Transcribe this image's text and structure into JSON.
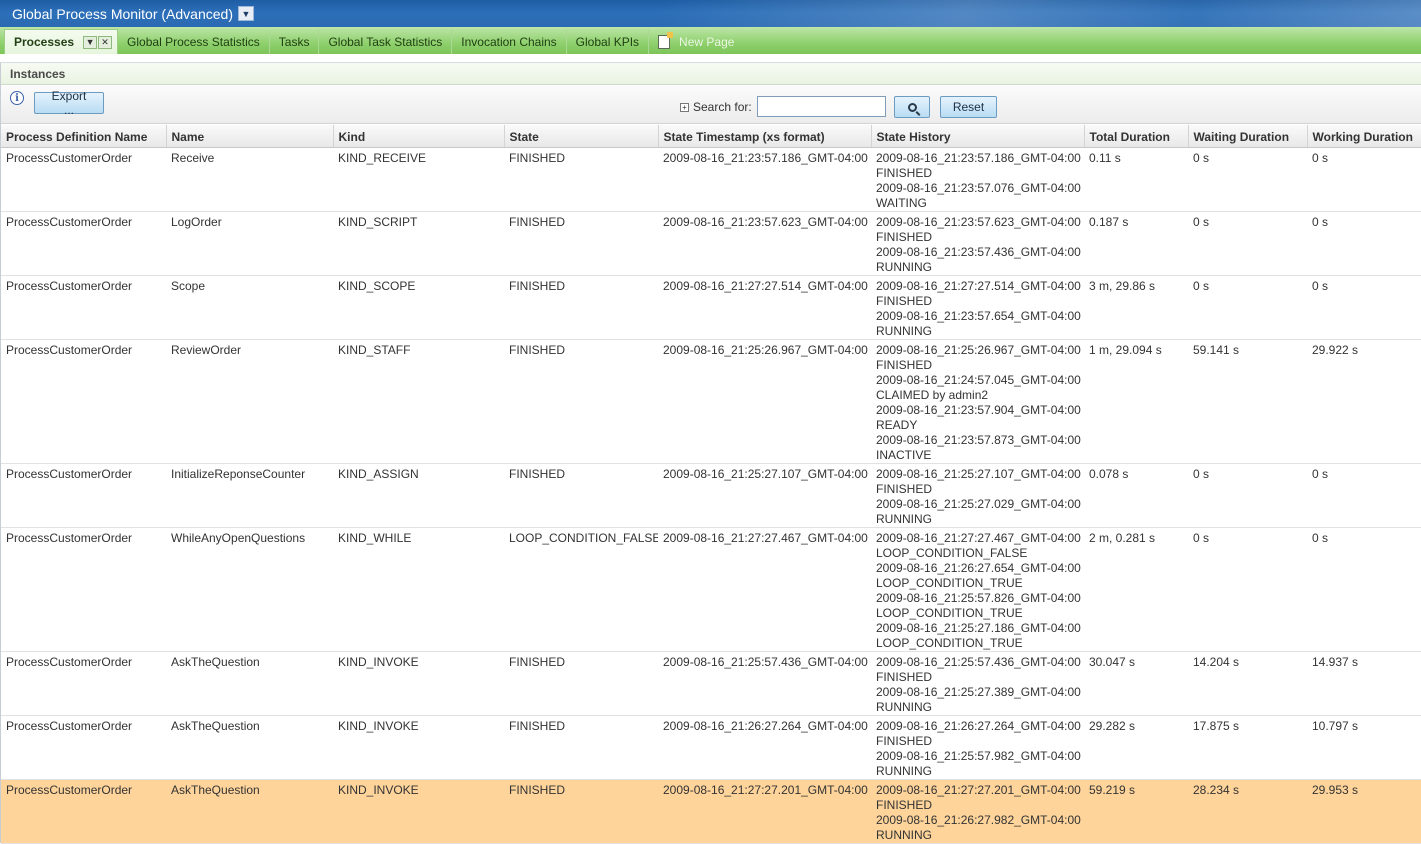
{
  "app": {
    "title": "Global Process Monitor (Advanced)"
  },
  "tabs": [
    {
      "label": "Processes",
      "active": true
    },
    {
      "label": "Global Process Statistics"
    },
    {
      "label": "Tasks"
    },
    {
      "label": "Global Task Statistics"
    },
    {
      "label": "Invocation Chains"
    },
    {
      "label": "Global KPIs"
    },
    {
      "label": "New Page"
    }
  ],
  "portlet": {
    "title": "Instances",
    "export_label": "Export ...",
    "search_label": "Search for:",
    "search_value": "",
    "reset_label": "Reset"
  },
  "table": {
    "columns": [
      "Process Definition Name",
      "Name",
      "Kind",
      "State",
      "State Timestamp (xs format)",
      "State History",
      "Total Duration",
      "Waiting Duration",
      "Working Duration"
    ],
    "rows": [
      {
        "process": "ProcessCustomerOrder",
        "name": "Receive",
        "kind": "KIND_RECEIVE",
        "state": "FINISHED",
        "timestamp": "2009-08-16_21:23:57.186_GMT-04:00",
        "history": [
          "2009-08-16_21:23:57.186_GMT-04:00",
          "FINISHED",
          "2009-08-16_21:23:57.076_GMT-04:00",
          "WAITING"
        ],
        "total": "0.11 s",
        "waiting": "0 s",
        "working": "0 s"
      },
      {
        "process": "ProcessCustomerOrder",
        "name": "LogOrder",
        "kind": "KIND_SCRIPT",
        "state": "FINISHED",
        "timestamp": "2009-08-16_21:23:57.623_GMT-04:00",
        "history": [
          "2009-08-16_21:23:57.623_GMT-04:00",
          "FINISHED",
          "2009-08-16_21:23:57.436_GMT-04:00",
          "RUNNING"
        ],
        "total": "0.187 s",
        "waiting": "0 s",
        "working": "0 s"
      },
      {
        "process": "ProcessCustomerOrder",
        "name": "Scope",
        "kind": "KIND_SCOPE",
        "state": "FINISHED",
        "timestamp": "2009-08-16_21:27:27.514_GMT-04:00",
        "history": [
          "2009-08-16_21:27:27.514_GMT-04:00",
          "FINISHED",
          "2009-08-16_21:23:57.654_GMT-04:00",
          "RUNNING"
        ],
        "total": "3 m, 29.86 s",
        "waiting": "0 s",
        "working": "0 s"
      },
      {
        "process": "ProcessCustomerOrder",
        "name": "ReviewOrder",
        "kind": "KIND_STAFF",
        "state": "FINISHED",
        "timestamp": "2009-08-16_21:25:26.967_GMT-04:00",
        "history": [
          "2009-08-16_21:25:26.967_GMT-04:00",
          "FINISHED",
          "2009-08-16_21:24:57.045_GMT-04:00",
          "CLAIMED by admin2",
          "2009-08-16_21:23:57.904_GMT-04:00",
          "READY",
          "2009-08-16_21:23:57.873_GMT-04:00",
          "INACTIVE"
        ],
        "total": "1 m, 29.094 s",
        "waiting": "59.141 s",
        "working": "29.922 s"
      },
      {
        "process": "ProcessCustomerOrder",
        "name": "InitializeReponseCounter",
        "kind": "KIND_ASSIGN",
        "state": "FINISHED",
        "timestamp": "2009-08-16_21:25:27.107_GMT-04:00",
        "history": [
          "2009-08-16_21:25:27.107_GMT-04:00",
          "FINISHED",
          "2009-08-16_21:25:27.029_GMT-04:00",
          "RUNNING"
        ],
        "total": "0.078 s",
        "waiting": "0 s",
        "working": "0 s"
      },
      {
        "process": "ProcessCustomerOrder",
        "name": "WhileAnyOpenQuestions",
        "kind": "KIND_WHILE",
        "state": "LOOP_CONDITION_FALSE",
        "timestamp": "2009-08-16_21:27:27.467_GMT-04:00",
        "history": [
          "2009-08-16_21:27:27.467_GMT-04:00",
          "LOOP_CONDITION_FALSE",
          "2009-08-16_21:26:27.654_GMT-04:00",
          "LOOP_CONDITION_TRUE",
          "2009-08-16_21:25:57.826_GMT-04:00",
          "LOOP_CONDITION_TRUE",
          "2009-08-16_21:25:27.186_GMT-04:00",
          "LOOP_CONDITION_TRUE"
        ],
        "total": "2 m, 0.281 s",
        "waiting": "0 s",
        "working": "0 s"
      },
      {
        "process": "ProcessCustomerOrder",
        "name": "AskTheQuestion",
        "kind": "KIND_INVOKE",
        "state": "FINISHED",
        "timestamp": "2009-08-16_21:25:57.436_GMT-04:00",
        "history": [
          "2009-08-16_21:25:57.436_GMT-04:00",
          "FINISHED",
          "2009-08-16_21:25:27.389_GMT-04:00",
          "RUNNING"
        ],
        "total": "30.047 s",
        "waiting": "14.204 s",
        "working": "14.937 s"
      },
      {
        "process": "ProcessCustomerOrder",
        "name": "AskTheQuestion",
        "kind": "KIND_INVOKE",
        "state": "FINISHED",
        "timestamp": "2009-08-16_21:26:27.264_GMT-04:00",
        "history": [
          "2009-08-16_21:26:27.264_GMT-04:00",
          "FINISHED",
          "2009-08-16_21:25:57.982_GMT-04:00",
          "RUNNING"
        ],
        "total": "29.282 s",
        "waiting": "17.875 s",
        "working": "10.797 s"
      },
      {
        "process": "ProcessCustomerOrder",
        "name": "AskTheQuestion",
        "kind": "KIND_INVOKE",
        "state": "FINISHED",
        "timestamp": "2009-08-16_21:27:27.201_GMT-04:00",
        "history": [
          "2009-08-16_21:27:27.201_GMT-04:00",
          "FINISHED",
          "2009-08-16_21:26:27.982_GMT-04:00",
          "RUNNING"
        ],
        "total": "59.219 s",
        "waiting": "28.234 s",
        "working": "29.953 s",
        "selected": true
      }
    ]
  }
}
